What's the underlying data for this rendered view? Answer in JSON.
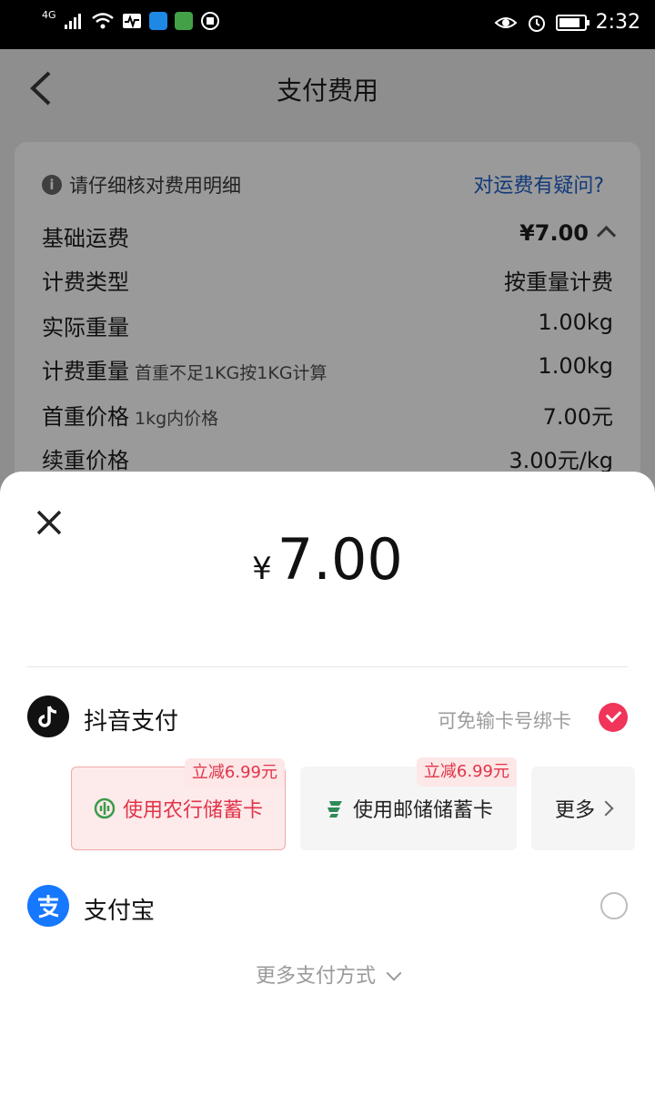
{
  "status_bar": {
    "network": "4G",
    "time": "2:32"
  },
  "header": {
    "title": "支付费用"
  },
  "fee_card": {
    "notice": "请仔细核对费用明细",
    "question_link": "对运费有疑问?",
    "rows": [
      {
        "label": "基础运费",
        "sub": "",
        "value": "¥7.00"
      },
      {
        "label": "计费类型",
        "sub": "",
        "value": "按重量计费"
      },
      {
        "label": "实际重量",
        "sub": "",
        "value": "1.00kg"
      },
      {
        "label": "计费重量",
        "sub": "首重不足1KG按1KG计算",
        "value": "1.00kg"
      },
      {
        "label": "首重价格",
        "sub": "1kg内价格",
        "value": "7.00元"
      },
      {
        "label": "续重价格",
        "sub": "",
        "value": "3.00元/kg"
      }
    ]
  },
  "sheet": {
    "currency": "¥",
    "amount": "7.00",
    "methods": [
      {
        "name": "抖音支付",
        "hint": "可免输卡号绑卡",
        "selected": true
      },
      {
        "name": "支付宝",
        "hint": "",
        "selected": false
      }
    ],
    "bank_cards": [
      {
        "label": "使用农行储蓄卡",
        "badge": "立减6.99元"
      },
      {
        "label": "使用邮储储蓄卡",
        "badge": "立减6.99元"
      },
      {
        "label": "更多"
      }
    ],
    "more_methods": "更多支付方式"
  },
  "colors": {
    "accent": "#f0345a",
    "link": "#123a7a",
    "alipay": "#1677ff"
  }
}
